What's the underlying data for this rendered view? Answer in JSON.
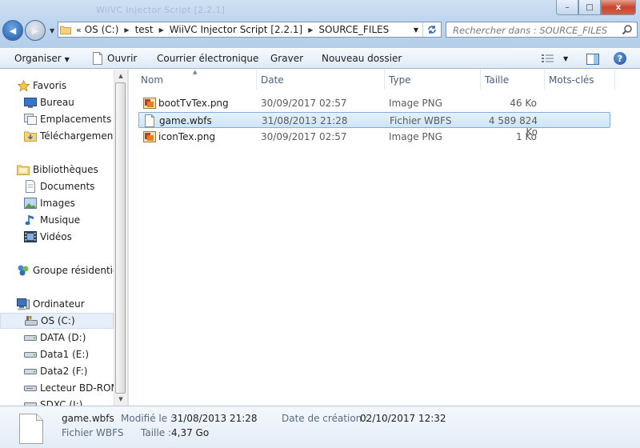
{
  "window": {
    "ghost_title": "WiiVC Injector Script [2.2.1]",
    "controls": {
      "minimize": "–",
      "maximize": "□",
      "close": "x"
    }
  },
  "navigation": {
    "back_glyph": "◀",
    "forward_glyph": "▶"
  },
  "address": {
    "overflow": "«",
    "crumbs": [
      "OS (C:)",
      "test",
      "WiiVC Injector Script [2.2.1]",
      "SOURCE_FILES"
    ],
    "separator": "▶"
  },
  "search": {
    "placeholder": "Rechercher dans : SOURCE_FILES"
  },
  "toolbar": {
    "organize": "Organiser",
    "open": "Ouvrir",
    "email": "Courrier électronique",
    "burn": "Graver",
    "new_folder": "Nouveau dossier",
    "help": "?"
  },
  "nav_pane": {
    "favorites": "Favoris",
    "fav_items": [
      "Bureau",
      "Emplacements ré",
      "Téléchargements"
    ],
    "libraries": "Bibliothèques",
    "lib_items": [
      "Documents",
      "Images",
      "Musique",
      "Vidéos"
    ],
    "homegroup": "Groupe résidentiel",
    "computer": "Ordinateur",
    "drives": [
      "OS (C:)",
      "DATA (D:)",
      "Data1 (E:)",
      "Data2 (F:)",
      "Lecteur BD-ROM",
      "SDXC (I:)"
    ],
    "selected": "OS (C:)"
  },
  "columns": {
    "name": "Nom",
    "date": "Date",
    "type": "Type",
    "size": "Taille",
    "tags": "Mots-clés"
  },
  "files": [
    {
      "name": "bootTvTex.png",
      "date": "30/09/2017 02:57",
      "type": "Image PNG",
      "size": "46 Ko",
      "icon": "png-image-icon"
    },
    {
      "name": "game.wbfs",
      "date": "31/08/2013 21:28",
      "type": "Fichier WBFS",
      "size": "4 589 824 Ko",
      "icon": "generic-file-icon",
      "selected": true
    },
    {
      "name": "iconTex.png",
      "date": "30/09/2017 02:57",
      "type": "Image PNG",
      "size": "1 Ko",
      "icon": "png-image-icon"
    }
  ],
  "details": {
    "name": "game.wbfs",
    "type": "Fichier WBFS",
    "modified_label": "Modifié le :",
    "modified_value": "31/08/2013 21:28",
    "size_label": "Taille :",
    "size_value": "4,37 Go",
    "created_label": "Date de création :",
    "created_value": "02/10/2017 12:32"
  }
}
